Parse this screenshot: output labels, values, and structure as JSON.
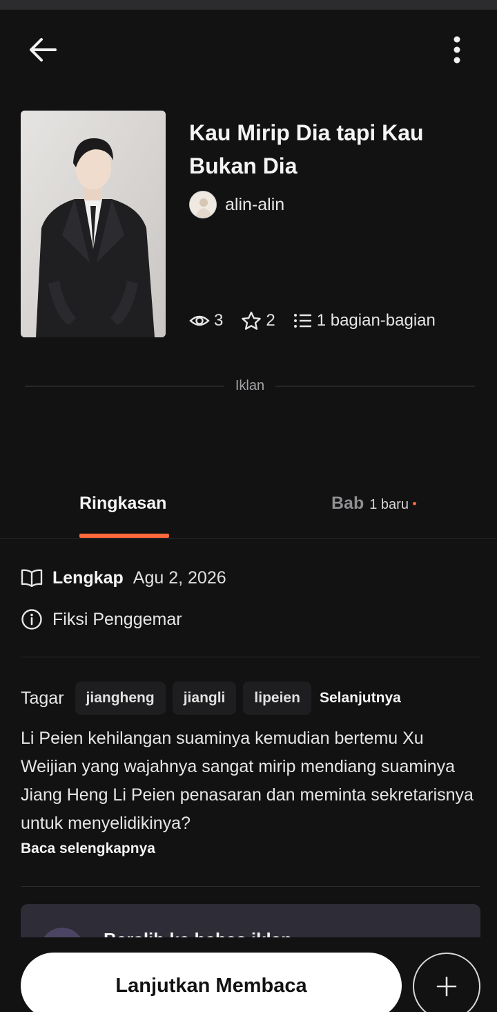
{
  "header": {
    "back_icon": "arrow-left-icon",
    "more_icon": "more-vertical-icon"
  },
  "story": {
    "title": "Kau Mirip Dia tapi Kau Bukan Dia",
    "author": "alin-alin",
    "views": "3",
    "votes": "2",
    "parts": "1 bagian-bagian"
  },
  "ad": {
    "label": "Iklan"
  },
  "tabs": {
    "summary": "Ringkasan",
    "chapters": "Bab",
    "chapters_new": "1 baru"
  },
  "details": {
    "status_label": "Lengkap",
    "status_date": "Agu 2, 2026",
    "genre": "Fiksi Penggemar"
  },
  "tags": {
    "label": "Tagar",
    "items": [
      "jiangheng",
      "jiangli",
      "lipeien"
    ],
    "more": "Selanjutnya"
  },
  "synopsis": {
    "text": "Li Peien kehilangan suaminya kemudian bertemu Xu Weijian yang wajahnya sangat mirip mendiang suaminya Jiang Heng Li Peien penasaran dan meminta sekretarisnya untuk menyelidikinya?",
    "read_more": "Baca selengkapnya"
  },
  "promo": {
    "text": "Beralih ke bebas iklan"
  },
  "footer": {
    "continue_label": "Lanjutkan Membaca"
  },
  "colors": {
    "background": "#121213",
    "accent": "#ff6a3d",
    "text": "#ececec",
    "muted": "#8f8f92"
  }
}
